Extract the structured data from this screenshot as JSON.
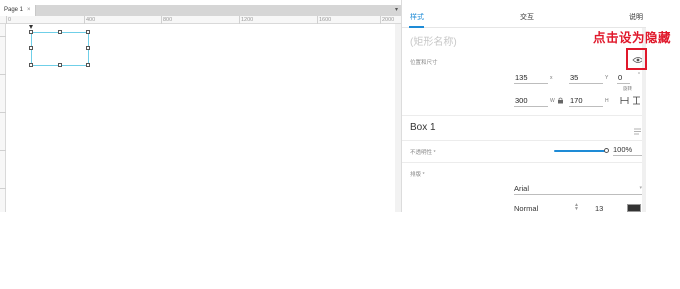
{
  "canvas": {
    "page_tab": "Page 1",
    "page_tab_close": "×",
    "tab_dropdown": "▾",
    "ruler_ticks": [
      "0",
      "400",
      "800",
      "1200",
      "1600",
      "2000"
    ]
  },
  "panel": {
    "tabs": [
      {
        "label": "样式",
        "active": true
      },
      {
        "label": "交互",
        "active": false
      },
      {
        "label": "说明",
        "active": false
      }
    ],
    "shape_name_placeholder": "(矩形名称)",
    "position_size_label": "位置和尺寸",
    "x": {
      "value": "135",
      "axis": "x"
    },
    "y": {
      "value": "35",
      "axis": "Y"
    },
    "rotation": {
      "value": "0",
      "unit": "°",
      "label": "旋转"
    },
    "width": {
      "value": "300",
      "axis": "W"
    },
    "height": {
      "value": "170",
      "axis": "H"
    },
    "box_name": "Box 1",
    "opacity_label": "不透明性 *",
    "opacity_value": "100%",
    "opacity_fraction": 1.0,
    "typography_label": "排版 *",
    "font_family": "Arial",
    "font_dropdown": "▾",
    "font_weight": "Normal",
    "font_size": "13",
    "text_color": "#333333",
    "icons": {
      "visibility": "eye-icon",
      "lock": "lock-icon",
      "fit_width": "fit-width-icon",
      "fit_height": "fit-height-icon",
      "style": "style-icon"
    },
    "accent_color": "#1e8bd6"
  },
  "annotation": {
    "text": "点击设为隐藏",
    "color": "#e0182b"
  }
}
